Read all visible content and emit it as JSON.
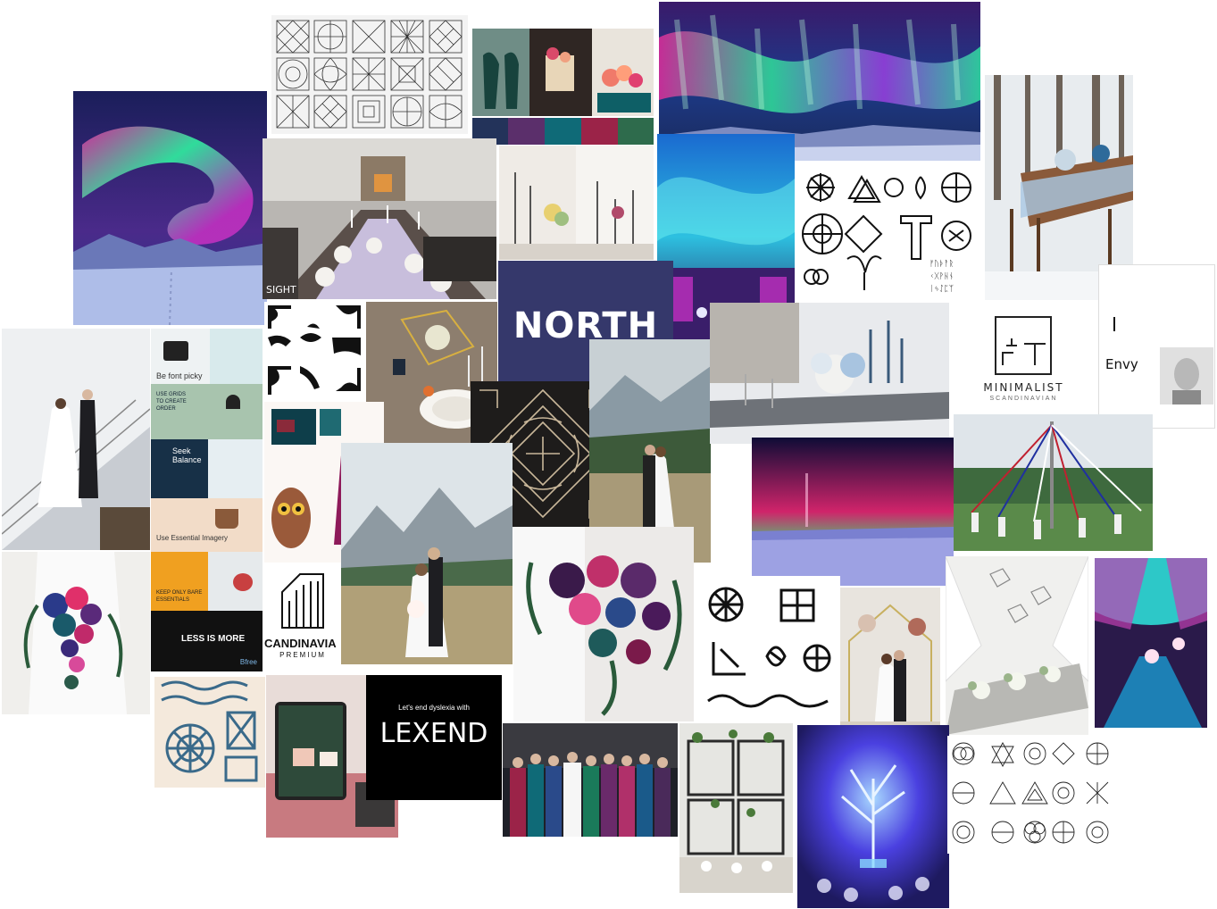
{
  "tiles": {
    "north": {
      "word": "NORTH",
      "bg": "#35386b"
    },
    "lexend": {
      "tagline": "Let's end dyslexia with",
      "word": "LEXEND"
    },
    "minimalist": {
      "title": "MINIMALIST",
      "subtitle": "SCANDINAVIAN"
    },
    "envy": {
      "title": "Envy"
    },
    "scandinavian_premium": {
      "title": "CANDINAVIA",
      "subtitle": "PREMIUM"
    },
    "brand_board": {
      "be_fonts": "Be font picky",
      "use_grids": "USE GRIDS TO CREATE ORDER",
      "seek_balance": "Seek Balance",
      "use_essential": "Use Essential Imagery",
      "keep_bare": "KEEP ONLY BARE ESSENTIALS",
      "less_is_more": "LESS IS MORE",
      "brand": "Bfree"
    },
    "sight": {
      "label": "SIGHT"
    }
  },
  "palette": {
    "navy": "#23335a",
    "plum": "#5b2f6b",
    "teal": "#0f6a77",
    "berry": "#9b2348",
    "green": "#2e6b4c",
    "aurora_green": "#2fe39a",
    "aurora_pink": "#e0309a",
    "night": "#141a4a"
  },
  "icons": [
    "geometric-pattern-icon",
    "norse-symbol-icon",
    "celtic-knot-icon",
    "corner-ornament-icon",
    "sacred-geometry-icon"
  ]
}
